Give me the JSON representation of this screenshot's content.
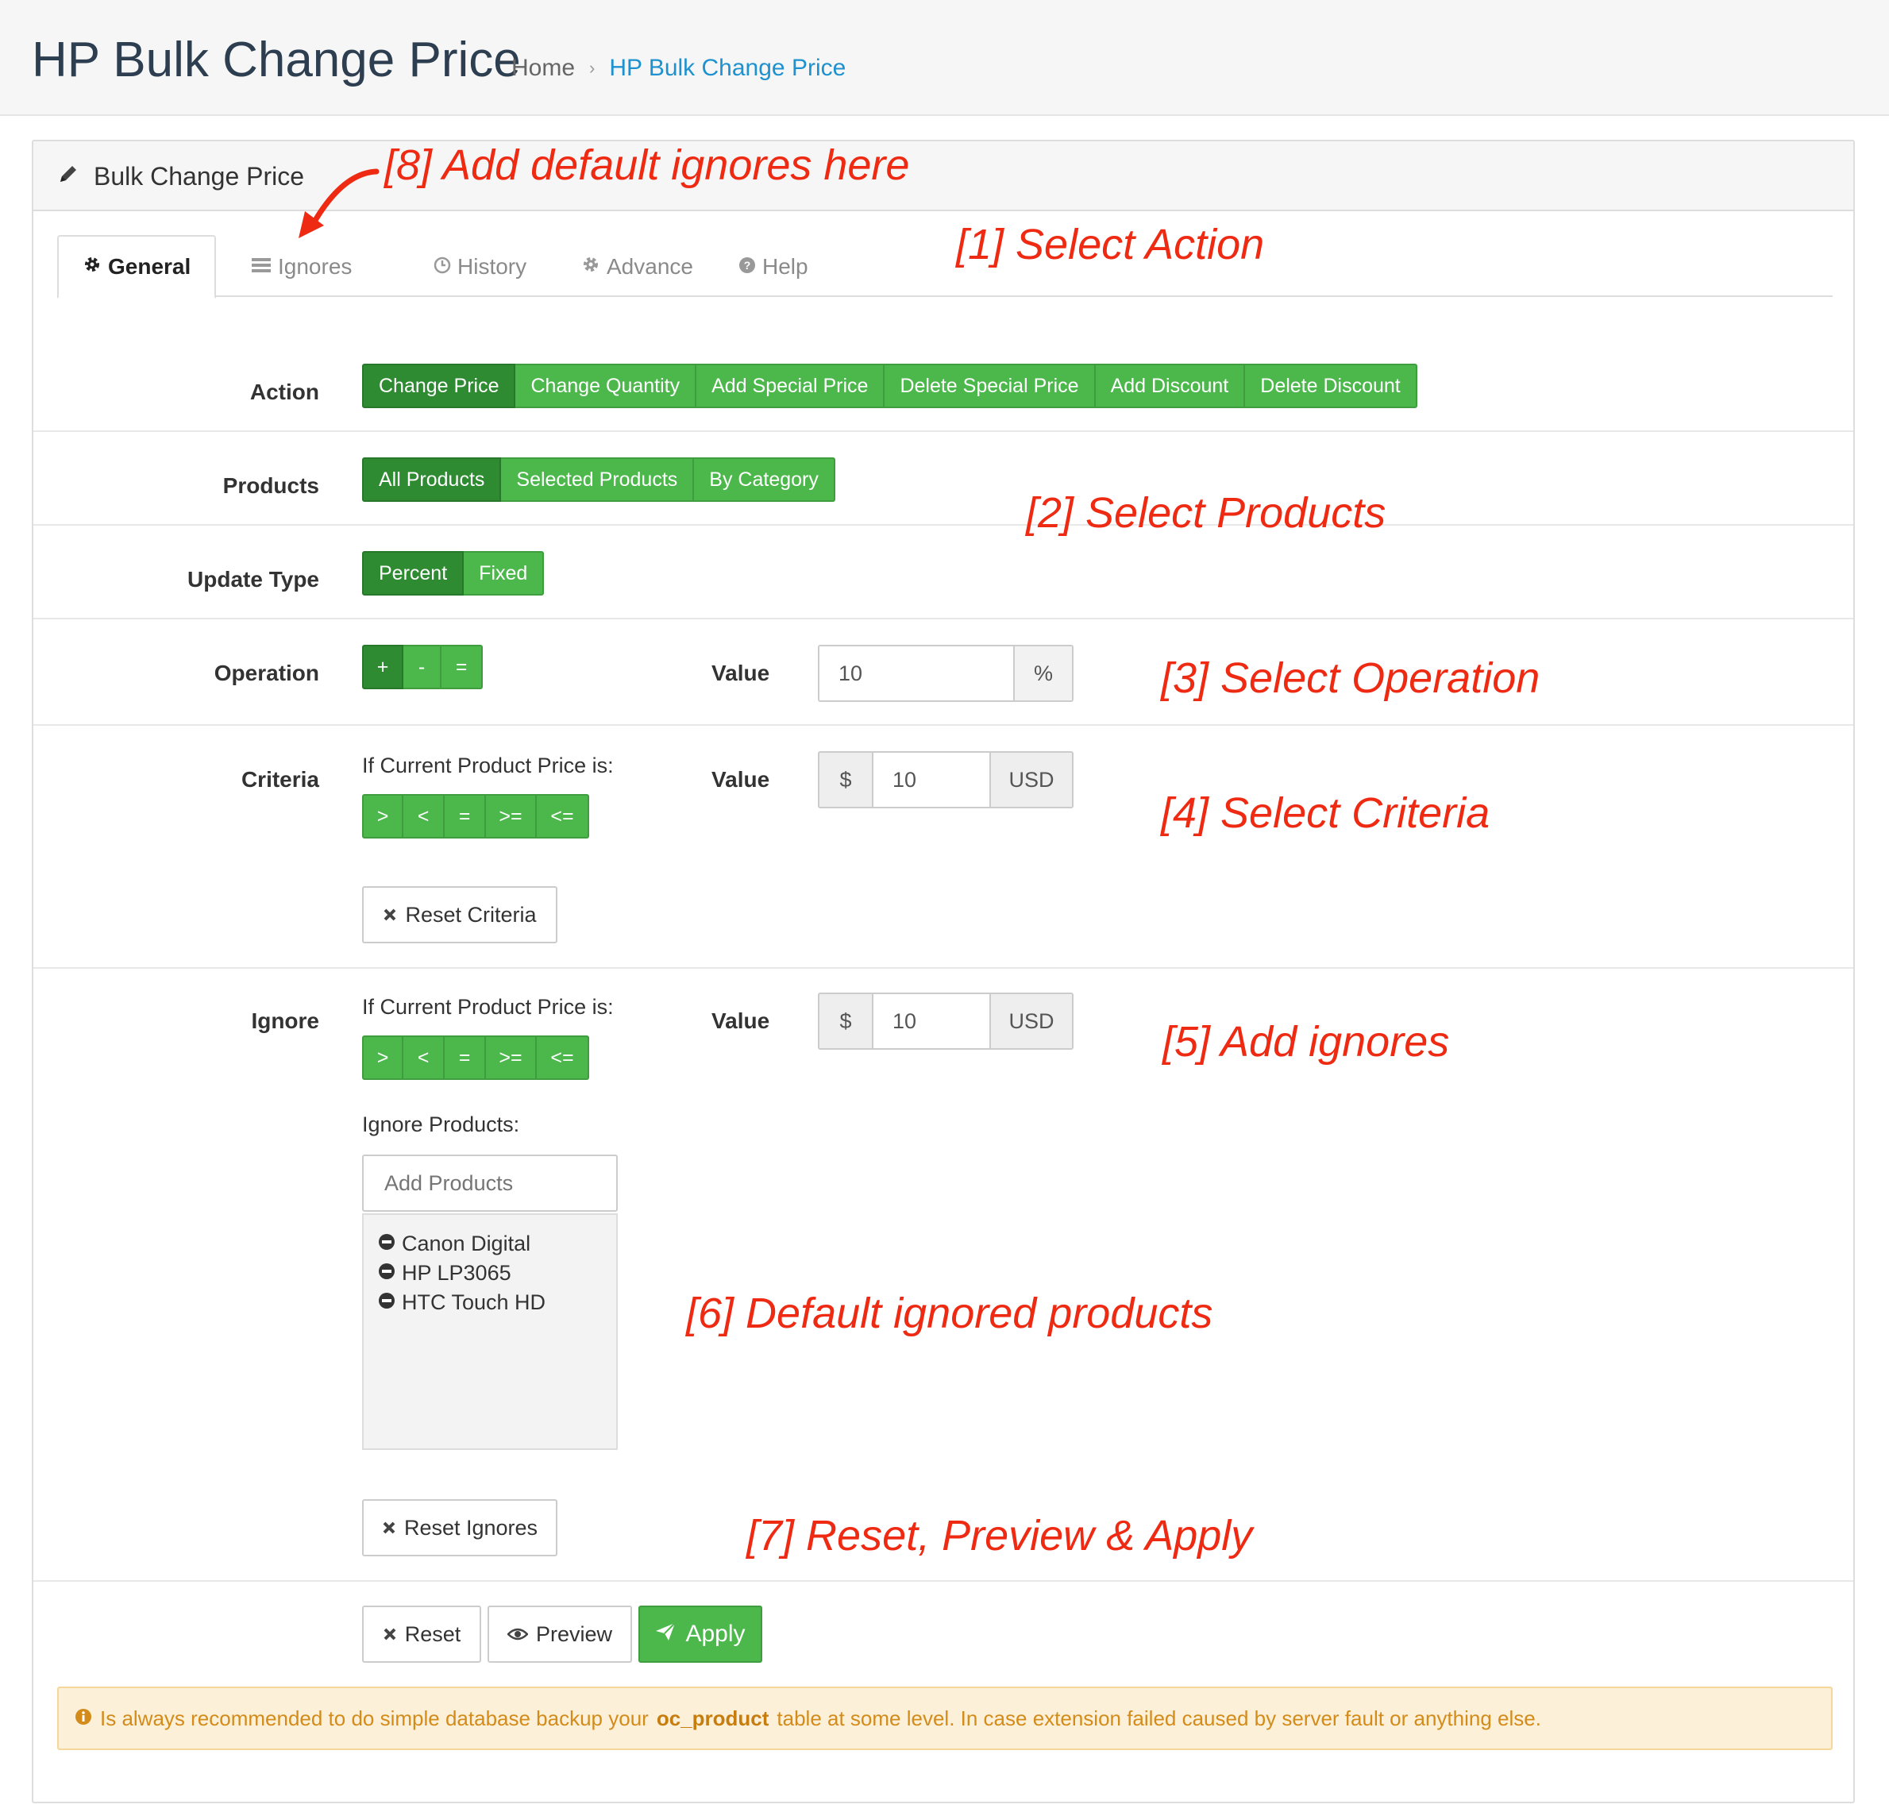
{
  "page": {
    "title": "HP Bulk Change Price",
    "breadcrumb": {
      "home": "Home",
      "separator": "›",
      "current": "HP Bulk Change Price"
    }
  },
  "panel": {
    "title": "Bulk Change Price"
  },
  "tabs": [
    {
      "label": "General",
      "icon": "gear-icon",
      "active": true
    },
    {
      "label": "Ignores",
      "icon": "list-icon"
    },
    {
      "label": "History",
      "icon": "clock-icon"
    },
    {
      "label": "Advance",
      "icon": "gear-icon"
    },
    {
      "label": "Help",
      "icon": "question-icon"
    }
  ],
  "form": {
    "action": {
      "label": "Action",
      "options": [
        "Change Price",
        "Change Quantity",
        "Add Special Price",
        "Delete Special Price",
        "Add Discount",
        "Delete Discount"
      ],
      "selected": "Change Price"
    },
    "products": {
      "label": "Products",
      "options": [
        "All Products",
        "Selected Products",
        "By Category"
      ],
      "selected": "All Products"
    },
    "update_type": {
      "label": "Update Type",
      "options": [
        "Percent",
        "Fixed"
      ],
      "selected": "Percent"
    },
    "operation": {
      "label": "Operation",
      "options": [
        "+",
        "-",
        "="
      ],
      "selected": "+",
      "value_label": "Value",
      "value": "10",
      "unit": "%"
    },
    "criteria": {
      "label": "Criteria",
      "hint": "If Current Product Price is:",
      "options": [
        ">",
        "<",
        "=",
        ">=",
        "<="
      ],
      "value_label": "Value",
      "prefix": "$",
      "value": "10",
      "suffix": "USD",
      "reset_label": "Reset Criteria"
    },
    "ignore": {
      "label": "Ignore",
      "hint": "If Current Product Price is:",
      "options": [
        ">",
        "<",
        "=",
        ">=",
        "<="
      ],
      "value_label": "Value",
      "prefix": "$",
      "value": "10",
      "suffix": "USD",
      "products_label": "Ignore Products:",
      "add_placeholder": "Add Products",
      "products": [
        "Canon Digital",
        "HP LP3065",
        "HTC Touch HD"
      ],
      "reset_label": "Reset Ignores"
    }
  },
  "actions": {
    "reset": "Reset",
    "preview": "Preview",
    "apply": "Apply"
  },
  "alert": {
    "before": "Is always recommended to do simple database backup your",
    "table": "oc_product",
    "after": "table at some level. In case extension failed caused by server fault or anything else."
  },
  "annotations": {
    "a1": "[1] Select Action",
    "a2": "[2] Select Products",
    "a3": "[3] Select Operation",
    "a4": "[4] Select Criteria",
    "a5": "[5] Add ignores",
    "a6": "[6] Default ignored products",
    "a7": "[7] Reset, Preview & Apply",
    "a8": "[8] Add default ignores here"
  },
  "colors": {
    "green": "#4cb84c",
    "green_active": "#2e8b32",
    "annotation_red": "#ee2a13",
    "link_blue": "#1e91cf",
    "alert_bg": "#fcf0d8"
  }
}
